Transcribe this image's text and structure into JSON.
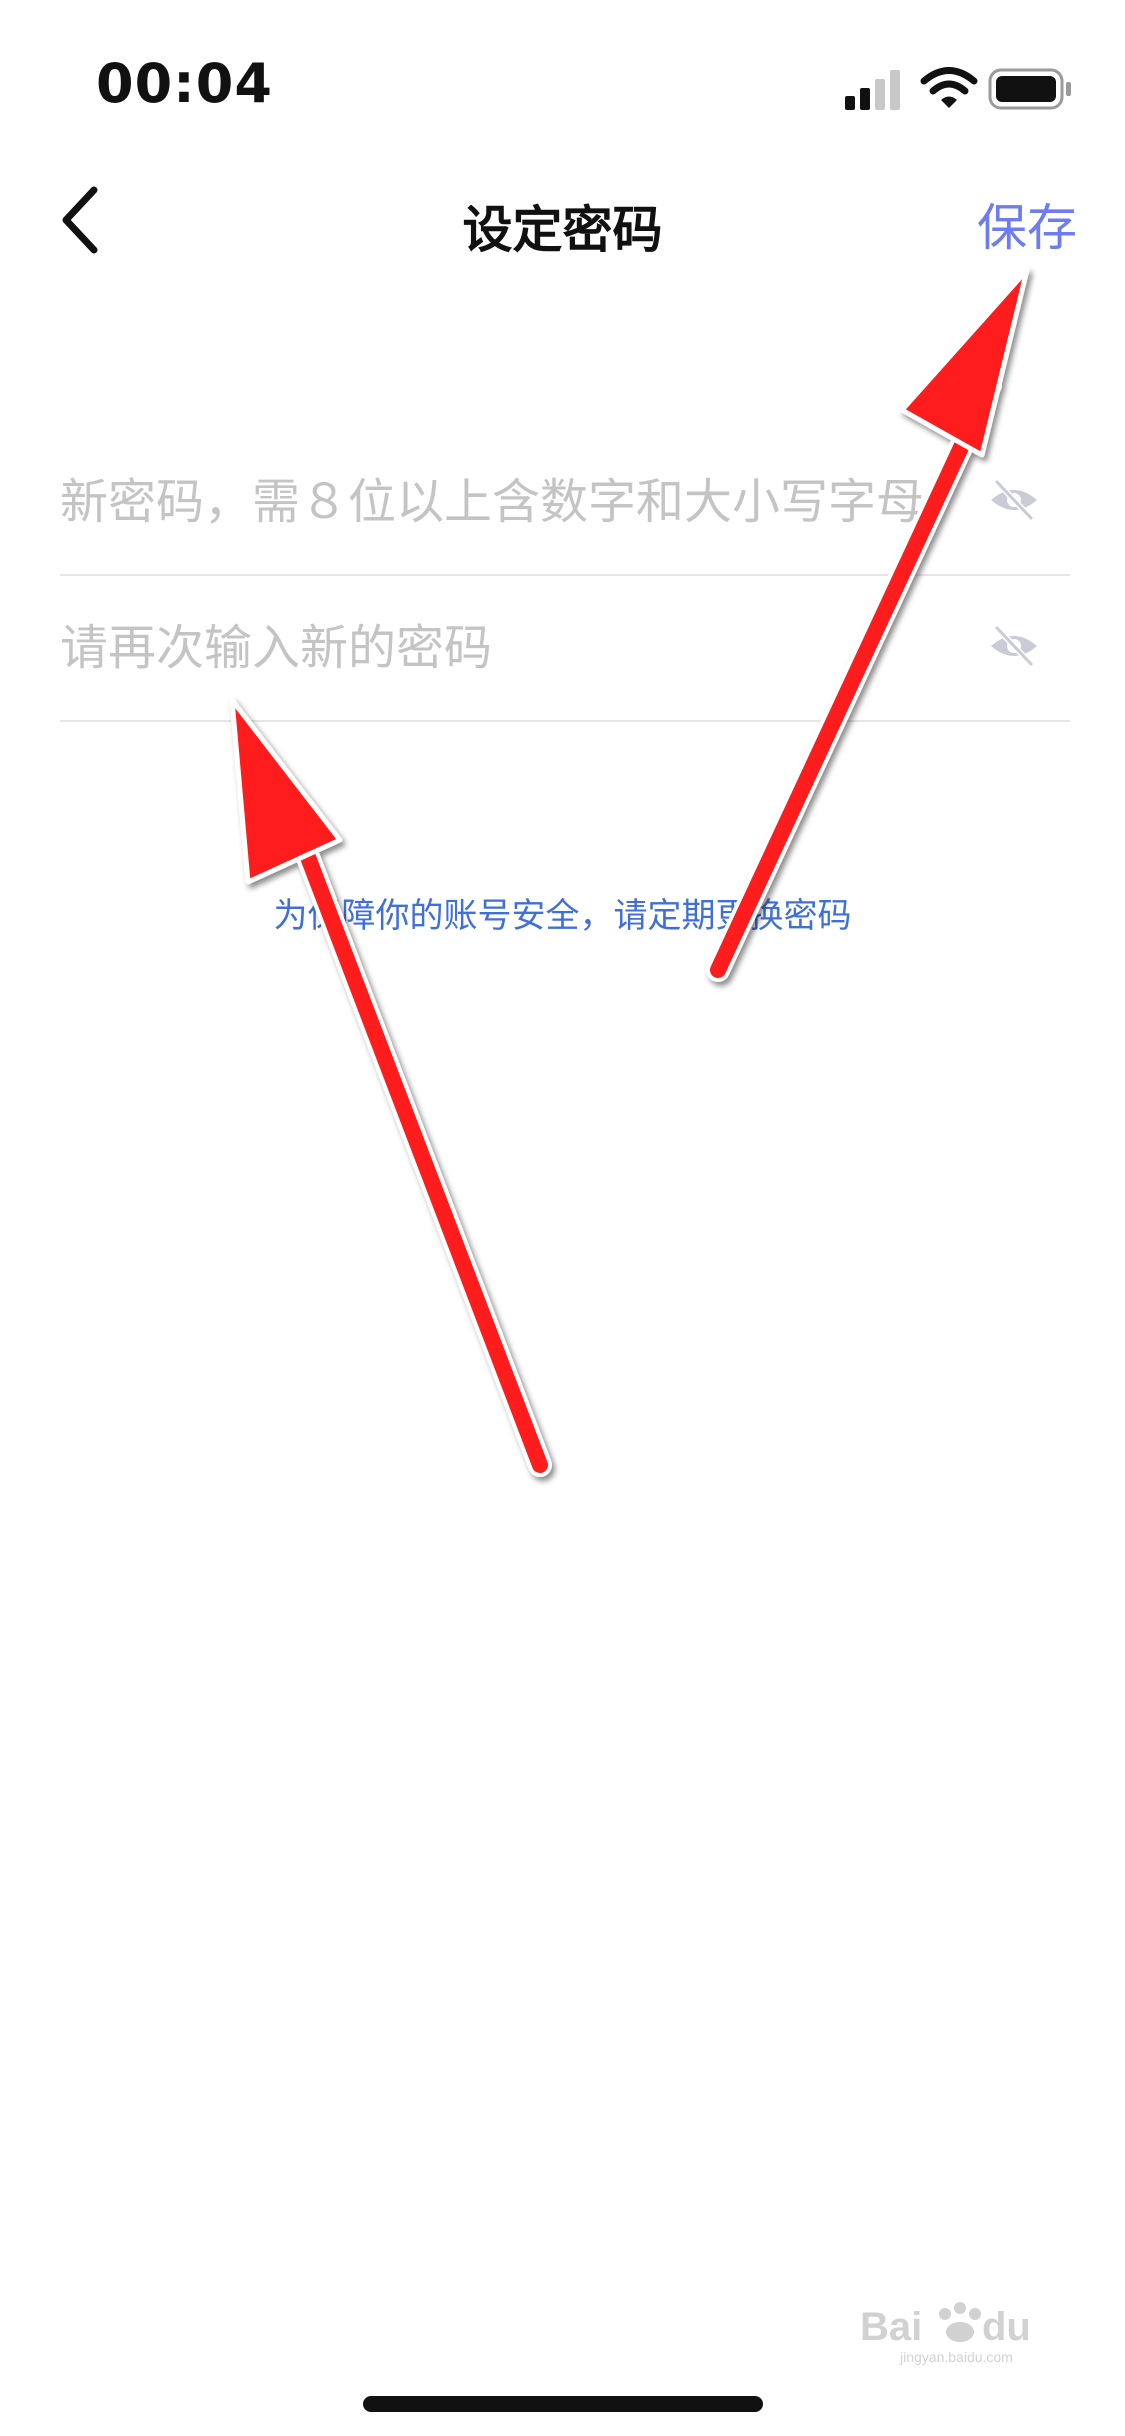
{
  "status": {
    "time": "00:04"
  },
  "nav": {
    "title": "设定密码",
    "save_label": "保存"
  },
  "form": {
    "new_password_placeholder": "新密码，需８位以上含数字和大小写字母",
    "confirm_password_placeholder": "请再次输入新的密码"
  },
  "notice": "为保障你的账号安全，请定期更换密码",
  "watermark": {
    "brand": "Baidu 经验",
    "url": "jingyan.baidu.com"
  },
  "colors": {
    "accent": "#6d7cf0",
    "notice": "#3f6fd8",
    "annotation_arrow": "#ff1a1a"
  },
  "icons": [
    "chevron-left-icon",
    "signal-icon",
    "wifi-icon",
    "battery-icon",
    "eye-off-icon"
  ]
}
